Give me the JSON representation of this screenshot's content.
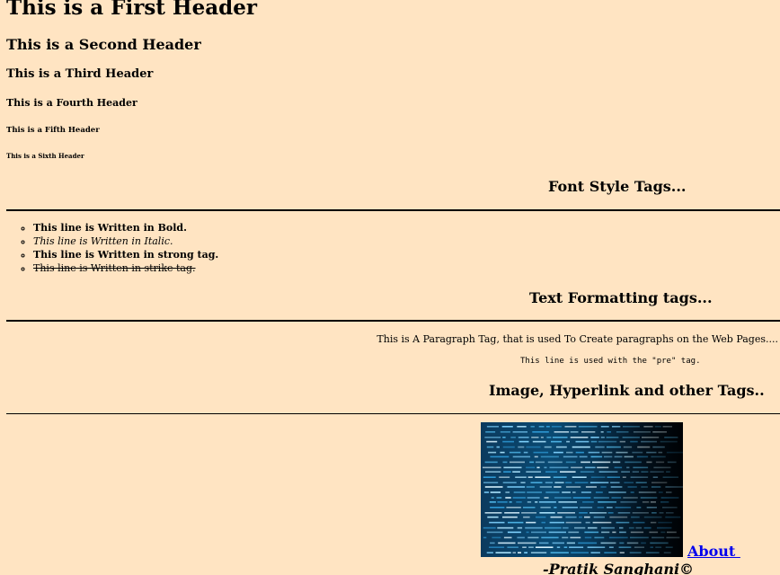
{
  "headers": {
    "h1": "This is a First Header",
    "h2": "This is a Second Header",
    "h3": "This is a Third Header",
    "h4": "This is a Fourth Header",
    "h5": "This is a Fifth Header",
    "h6": "This is a Sixth Header"
  },
  "font_style": {
    "title": "Font Style Tags...",
    "items": {
      "bold": "This line is Written in Bold.",
      "italic": "This line is Written in Italic.",
      "strong": "This line is Written in strong tag.",
      "strike": "This line is Written in strike tag."
    }
  },
  "text_formatting": {
    "title": "Text Formatting tags...",
    "paragraph": "This is A Paragraph Tag, that is used To Create paragraphs on the Web Pages....",
    "pre": "This line is used with the \"pre\" tag."
  },
  "image_section": {
    "title": "Image, Hyperlink and other Tags..",
    "link_label": "About ",
    "signature": "-Pratik Sanghani©"
  },
  "colors": {
    "background": "#ffe4c2",
    "link": "#0000ee"
  }
}
